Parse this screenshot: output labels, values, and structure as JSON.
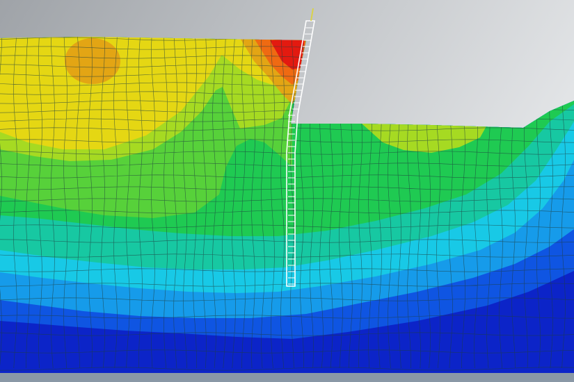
{
  "scene": {
    "background_top": "#9fa3a8",
    "background_bottom": "#e6e8ea",
    "footer_bar_color": "#8a98a6",
    "mesh_line_color": "#1f3f3f",
    "wall_color": "#ffffff",
    "contour_palette": {
      "red": "#e31a10",
      "orange": "#ef6a12",
      "amber": "#e3a514",
      "yellow": "#e5d713",
      "yellow_green": "#a6da22",
      "light_green": "#57d13a",
      "green": "#1fca52",
      "teal_green": "#17c8a2",
      "cyan": "#18c9e6",
      "sky_blue": "#169bea",
      "blue": "#0f55e2",
      "deep_blue": "#0c24c8"
    }
  }
}
